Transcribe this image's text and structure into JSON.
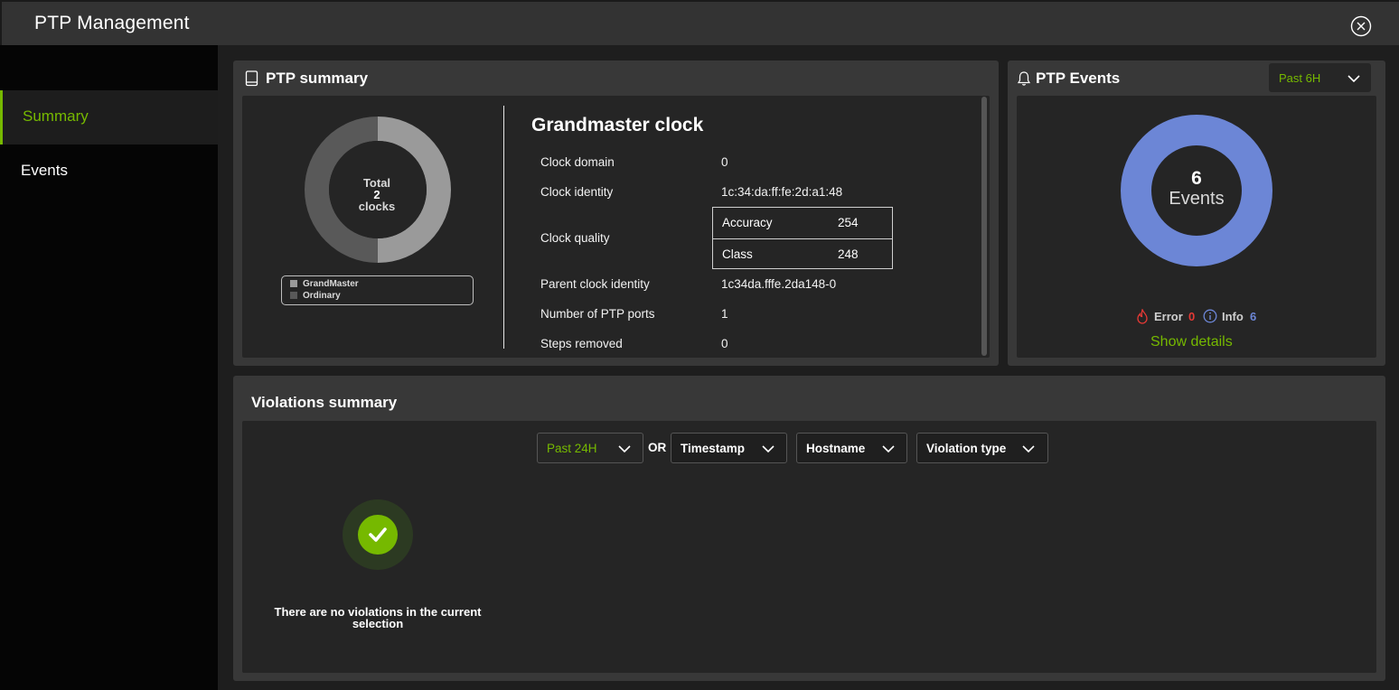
{
  "window": {
    "title": "PTP Management"
  },
  "sidebar": {
    "items": [
      {
        "label": "Summary",
        "active": true
      },
      {
        "label": "Events",
        "active": false
      }
    ]
  },
  "ptp_summary": {
    "title": "PTP summary",
    "donut": {
      "center_line1": "Total",
      "center_count": "2",
      "center_line2": "clocks",
      "segments": [
        {
          "name": "GrandMaster",
          "value": 1,
          "color": "#9a9a9a"
        },
        {
          "name": "Ordinary",
          "value": 1,
          "color": "#595959"
        }
      ]
    },
    "grandmaster": {
      "heading": "Grandmaster clock",
      "clock_domain_label": "Clock domain",
      "clock_domain_value": "0",
      "clock_identity_label": "Clock identity",
      "clock_identity_value": "1c:34:da:ff:fe:2d:a1:48",
      "clock_quality_label": "Clock quality",
      "quality": [
        {
          "key": "Accuracy",
          "value": "254"
        },
        {
          "key": "Class",
          "value": "248"
        }
      ],
      "parent_identity_label": "Parent clock identity",
      "parent_identity_value": "1c34da.fffe.2da148-0",
      "ports_label": "Number of PTP ports",
      "ports_value": "1",
      "steps_label": "Steps removed",
      "steps_value": "0"
    }
  },
  "ptp_events": {
    "title": "PTP Events",
    "range": "Past 6H",
    "count": "6",
    "count_label": "Events",
    "error_label": "Error",
    "error_count": "0",
    "info_label": "Info",
    "info_count": "6",
    "show_details": "Show details",
    "colors": {
      "ring": "#6c86d6",
      "error": "#e53935",
      "info": "#6c86d6",
      "accent": "#76b900"
    }
  },
  "violations": {
    "title": "Violations summary",
    "filters": {
      "range": "Past 24H",
      "or_label": "OR",
      "timestamp": "Timestamp",
      "hostname": "Hostname",
      "violation_type": "Violation type"
    },
    "empty_message": "There are no violations in the current selection"
  }
}
